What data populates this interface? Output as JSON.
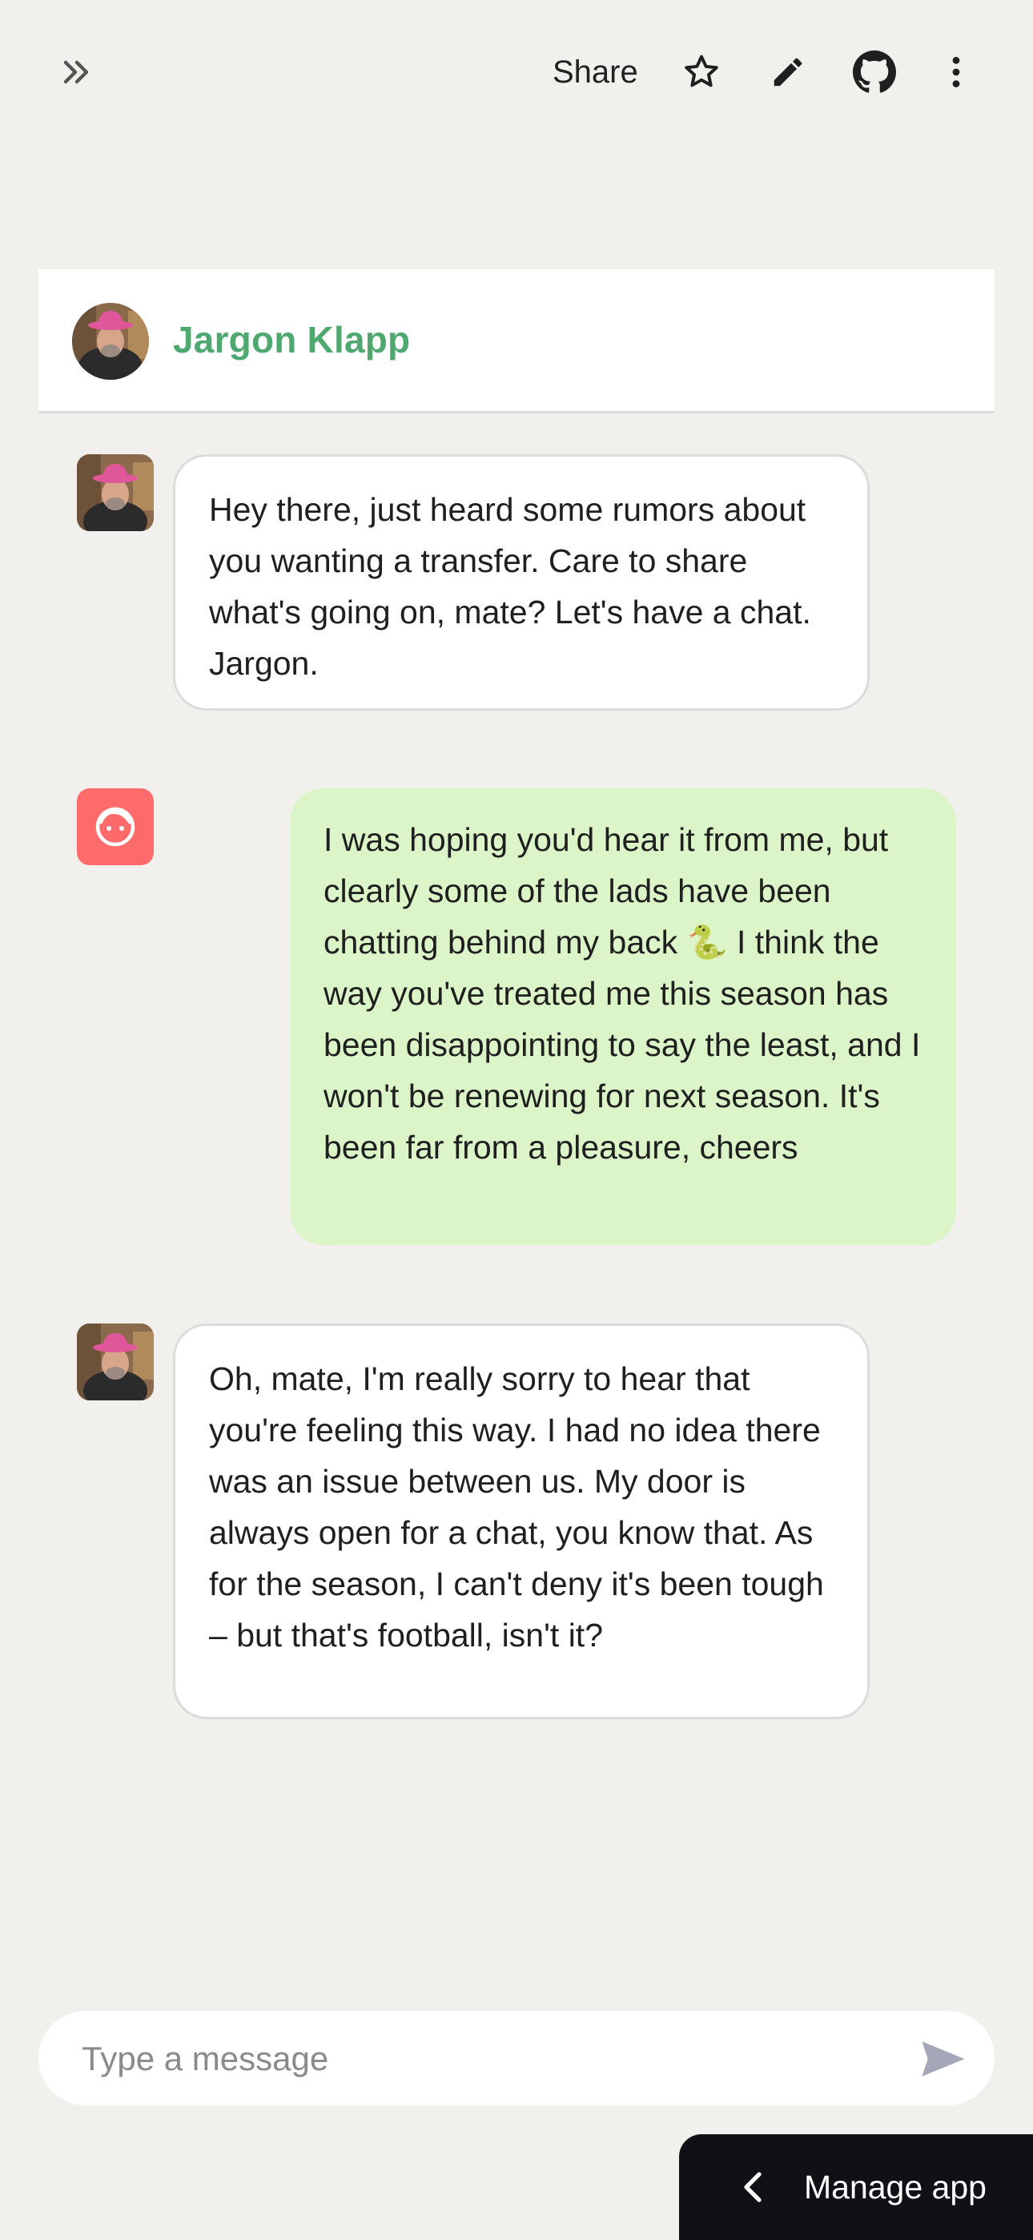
{
  "topbar": {
    "expand_icon": "double-chevron-right-icon",
    "share_label": "Share",
    "star_icon": "star-icon",
    "edit_icon": "pencil-icon",
    "github_icon": "github-icon",
    "menu_icon": "kebab-menu-icon"
  },
  "header": {
    "name": "Jargon Klapp",
    "name_color": "#4fa870"
  },
  "messages": [
    {
      "role": "assistant",
      "text": "Hey there, just heard some rumors about you wanting a transfer. Care to share what's going on, mate? Let's have a chat. Jargon."
    },
    {
      "role": "user",
      "text": "I was hoping you'd hear it from me, but clearly some of the lads have been chatting behind my back 🐍 I think the way you've treated me this season has been disappointing to say the least, and I won't be renewing for next season. It's been far from a pleasure, cheers"
    },
    {
      "role": "assistant",
      "text": "Oh, mate, I'm really sorry to hear that you're feeling this way. I had no idea there was an issue between us. My door is always open for a chat, you know that. As for the season, I can't deny it's been tough – but that's football, isn't it?"
    }
  ],
  "composer": {
    "placeholder": "Type a message",
    "value": "",
    "send_icon": "send-icon"
  },
  "manage_app": {
    "label": "Manage app",
    "icon": "chevron-left-icon"
  },
  "colors": {
    "background": "#f1f0ec",
    "user_bubble": "#dbf5c8",
    "user_avatar": "#ff6b6b",
    "manage_bar": "#0f1116"
  }
}
